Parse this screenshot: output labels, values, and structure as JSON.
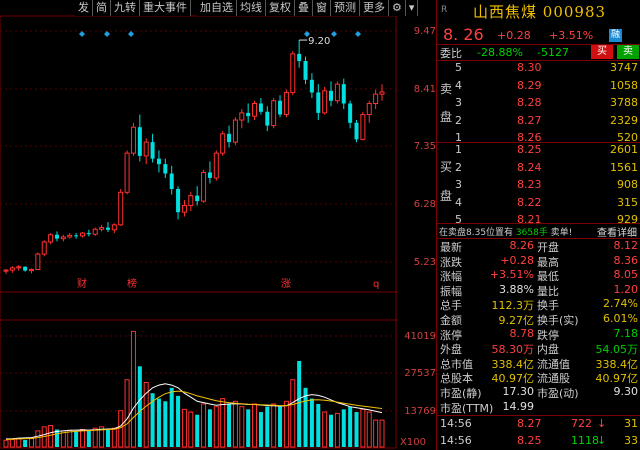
{
  "toolbar": [
    "发",
    "简",
    "九转",
    "重大事件",
    "加自选",
    "均线",
    "复权",
    "叠",
    "窗",
    "预测",
    "更多"
  ],
  "chart_data": {
    "type": "candlestick",
    "price_axis": {
      "ticks": [
        "9.47",
        "8.41",
        "7.35",
        "6.28",
        "5.23"
      ],
      "min": 4.85,
      "max": 9.6
    },
    "volume_axis": {
      "ticks": [
        "41019",
        "27537",
        "13769",
        "X100"
      ],
      "max": 43500
    },
    "high_label": "9.20",
    "event_labels": [
      "财",
      "榜",
      "涨",
      "q"
    ],
    "candles": [
      [
        5.01,
        5.05,
        4.96,
        5.03
      ],
      [
        5.03,
        5.1,
        4.98,
        5.07
      ],
      [
        5.07,
        5.12,
        5.02,
        5.09
      ],
      [
        5.09,
        5.1,
        5.0,
        5.02
      ],
      [
        5.02,
        5.06,
        4.97,
        5.04
      ],
      [
        5.04,
        5.35,
        5.03,
        5.32
      ],
      [
        5.32,
        5.57,
        5.28,
        5.54
      ],
      [
        5.54,
        5.7,
        5.5,
        5.67
      ],
      [
        5.67,
        5.73,
        5.55,
        5.6
      ],
      [
        5.6,
        5.67,
        5.55,
        5.63
      ],
      [
        5.63,
        5.7,
        5.6,
        5.66
      ],
      [
        5.66,
        5.7,
        5.6,
        5.65
      ],
      [
        5.65,
        5.72,
        5.62,
        5.7
      ],
      [
        5.7,
        5.76,
        5.64,
        5.68
      ],
      [
        5.68,
        5.8,
        5.65,
        5.77
      ],
      [
        5.77,
        5.85,
        5.73,
        5.8
      ],
      [
        5.8,
        5.9,
        5.72,
        5.76
      ],
      [
        5.76,
        5.88,
        5.7,
        5.85
      ],
      [
        5.85,
        6.5,
        5.83,
        6.44
      ],
      [
        6.44,
        7.2,
        6.4,
        7.15
      ],
      [
        7.15,
        7.7,
        7.1,
        7.62
      ],
      [
        7.62,
        7.85,
        7.0,
        7.1
      ],
      [
        7.1,
        7.42,
        6.95,
        7.35
      ],
      [
        7.35,
        7.5,
        6.98,
        7.05
      ],
      [
        7.05,
        7.2,
        6.8,
        6.95
      ],
      [
        6.95,
        7.05,
        6.7,
        6.78
      ],
      [
        6.78,
        6.92,
        6.4,
        6.5
      ],
      [
        6.5,
        6.55,
        5.95,
        6.08
      ],
      [
        6.08,
        6.3,
        6.0,
        6.2
      ],
      [
        6.2,
        6.45,
        6.1,
        6.38
      ],
      [
        6.38,
        6.55,
        6.2,
        6.28
      ],
      [
        6.28,
        6.85,
        6.25,
        6.8
      ],
      [
        6.8,
        7.0,
        6.6,
        6.7
      ],
      [
        6.7,
        7.2,
        6.65,
        7.15
      ],
      [
        7.15,
        7.55,
        7.1,
        7.5
      ],
      [
        7.5,
        7.65,
        7.25,
        7.35
      ],
      [
        7.35,
        7.8,
        7.3,
        7.75
      ],
      [
        7.75,
        7.95,
        7.6,
        7.88
      ],
      [
        7.88,
        8.05,
        7.7,
        7.82
      ],
      [
        7.82,
        8.1,
        7.75,
        8.05
      ],
      [
        8.05,
        8.15,
        7.85,
        7.9
      ],
      [
        7.9,
        8.0,
        7.55,
        7.65
      ],
      [
        7.65,
        8.15,
        7.6,
        8.1
      ],
      [
        8.1,
        8.2,
        7.8,
        7.85
      ],
      [
        7.85,
        8.3,
        7.8,
        8.25
      ],
      [
        8.25,
        9.0,
        8.2,
        8.95
      ],
      [
        8.95,
        9.2,
        8.7,
        8.82
      ],
      [
        8.82,
        8.9,
        8.4,
        8.48
      ],
      [
        8.48,
        8.6,
        8.15,
        8.25
      ],
      [
        8.25,
        8.4,
        7.75,
        7.88
      ],
      [
        7.88,
        8.35,
        7.85,
        8.28
      ],
      [
        8.28,
        8.45,
        8.0,
        8.1
      ],
      [
        8.1,
        8.45,
        8.05,
        8.4
      ],
      [
        8.4,
        8.5,
        7.95,
        8.05
      ],
      [
        8.05,
        8.1,
        7.6,
        7.7
      ],
      [
        7.7,
        7.75,
        7.35,
        7.4
      ],
      [
        7.4,
        7.9,
        7.38,
        7.85
      ],
      [
        7.85,
        8.1,
        7.7,
        8.05
      ],
      [
        8.05,
        8.3,
        7.95,
        8.22
      ],
      [
        8.22,
        8.4,
        8.1,
        8.26
      ]
    ],
    "volumes": [
      2500,
      2800,
      3000,
      2600,
      3100,
      6000,
      7500,
      8000,
      6500,
      6000,
      6200,
      6000,
      6500,
      6000,
      7000,
      7500,
      6800,
      7000,
      13500,
      25000,
      43000,
      30000,
      24000,
      20000,
      18000,
      17000,
      22000,
      19000,
      14000,
      13000,
      12000,
      16000,
      14000,
      15000,
      18000,
      16000,
      17000,
      15000,
      14000,
      16000,
      13000,
      15000,
      16000,
      15000,
      17000,
      25000,
      32000,
      22000,
      18000,
      16000,
      13000,
      12000,
      12500,
      14000,
      15000,
      13000,
      14000,
      13000,
      10000,
      10000
    ],
    "ma": [
      [
        3000,
        3100,
        3300,
        3400,
        3500,
        4000,
        4600,
        5300,
        5800,
        6000,
        6200,
        6300,
        6350,
        6300,
        6400,
        6600,
        6700,
        6800,
        7800,
        10500,
        14500,
        17500,
        20000,
        22000,
        23000,
        23500,
        23000,
        22000,
        20000,
        18500,
        17000,
        16500,
        16000,
        15500,
        15800,
        16000,
        16100,
        16000,
        15800,
        15800,
        15600,
        15400,
        15300,
        15200,
        15300,
        16500,
        18000,
        19000,
        19500,
        19200,
        18500,
        17500,
        16500,
        15800,
        15000,
        14600,
        14200,
        13800,
        13300,
        12800
      ],
      [
        2800,
        2900,
        3000,
        3100,
        3200,
        3500,
        3900,
        4400,
        4900,
        5300,
        5600,
        5800,
        6000,
        6100,
        6200,
        6350,
        6500,
        6600,
        7200,
        8600,
        11000,
        13200,
        15200,
        17000,
        18500,
        19800,
        20500,
        20800,
        20500,
        19800,
        19000,
        18400,
        17800,
        17200,
        16800,
        16500,
        16300,
        16100,
        15900,
        15800,
        15700,
        15600,
        15500,
        15400,
        15400,
        15800,
        16500,
        17100,
        17500,
        17600,
        17400,
        17100,
        16700,
        16300,
        15900,
        15500,
        15200,
        14900,
        14600,
        14300
      ]
    ]
  },
  "stock": {
    "market": "R",
    "name": "山西焦煤",
    "code": "000983",
    "price": "8. 26",
    "change": "+0.28",
    "pct": "+3.51%",
    "tag": "融"
  },
  "webi": {
    "label": "委比",
    "ratio": "-28.88%",
    "diff": "-5127",
    "buy": "买",
    "sell": "卖"
  },
  "sell_label": [
    "卖",
    "盘"
  ],
  "buy_label": [
    "买",
    "盘"
  ],
  "asks": [
    {
      "lv": "5",
      "price": "8.30",
      "vol": "3747"
    },
    {
      "lv": "4",
      "price": "8.29",
      "vol": "1058"
    },
    {
      "lv": "3",
      "price": "8.28",
      "vol": "3788"
    },
    {
      "lv": "2",
      "price": "8.27",
      "vol": "2329"
    },
    {
      "lv": "1",
      "price": "8.26",
      "vol": "520"
    }
  ],
  "bids": [
    {
      "lv": "1",
      "price": "8.25",
      "vol": "2601"
    },
    {
      "lv": "2",
      "price": "8.24",
      "vol": "1561"
    },
    {
      "lv": "3",
      "price": "8.23",
      "vol": "908"
    },
    {
      "lv": "4",
      "price": "8.22",
      "vol": "315"
    },
    {
      "lv": "5",
      "price": "8.21",
      "vol": "929"
    }
  ],
  "notice": {
    "pre": "在卖盘8.35位置有 ",
    "num": "3658手",
    "post": " 卖单!",
    "detail": "查看详细"
  },
  "stats": [
    {
      "k1": "最新",
      "v1": "8.26",
      "c1": "red",
      "k2": "开盘",
      "v2": "8.12",
      "c2": "red"
    },
    {
      "k1": "涨跌",
      "v1": "+0.28",
      "c1": "red",
      "k2": "最高",
      "v2": "8.36",
      "c2": "red"
    },
    {
      "k1": "涨幅",
      "v1": "+3.51%",
      "c1": "red",
      "k2": "最低",
      "v2": "8.05",
      "c2": "red"
    },
    {
      "k1": "振幅",
      "v1": "3.88%",
      "c1": "wht",
      "k2": "量比",
      "v2": "1.20",
      "c2": "red"
    },
    {
      "k1": "总手",
      "v1": "112.3万",
      "c1": "yel",
      "k2": "换手",
      "v2": "2.74%",
      "c2": "yel"
    },
    {
      "k1": "金额",
      "v1": "9.27亿",
      "c1": "yel",
      "k2": "换手(实)",
      "v2": "6.01%",
      "c2": "yel"
    },
    {
      "k1": "涨停",
      "v1": "8.78",
      "c1": "red",
      "k2": "跌停",
      "v2": "7.18",
      "c2": "grn"
    },
    {
      "k1": "外盘",
      "v1": "58.30万",
      "c1": "red",
      "k2": "内盘",
      "v2": "54.05万",
      "c2": "grn"
    },
    {
      "k1": "总市值",
      "v1": "338.4亿",
      "c1": "yel",
      "k2": "流通值",
      "v2": "338.4亿",
      "c2": "yel"
    },
    {
      "k1": "总股本",
      "v1": "40.97亿",
      "c1": "yel",
      "k2": "流通股",
      "v2": "40.97亿",
      "c2": "yel"
    },
    {
      "k1": "市盈(静)",
      "v1": "17.30",
      "c1": "wht",
      "k2": "市盈(动)",
      "v2": "9.30",
      "c2": "wht"
    },
    {
      "k1": "市盈(TTM)",
      "v1": "14.99",
      "c1": "wht",
      "k2": "",
      "v2": "",
      "c2": "wht"
    }
  ],
  "ticks": [
    {
      "t": "14:56",
      "p": "8.27",
      "v": "722",
      "arrow": "↓",
      "ac": "red",
      "vc": "red",
      "n": "31"
    },
    {
      "t": "14:56",
      "p": "8.25",
      "v": "1118",
      "arrow": "↓",
      "ac": "grn",
      "vc": "grn",
      "n": "33"
    }
  ]
}
